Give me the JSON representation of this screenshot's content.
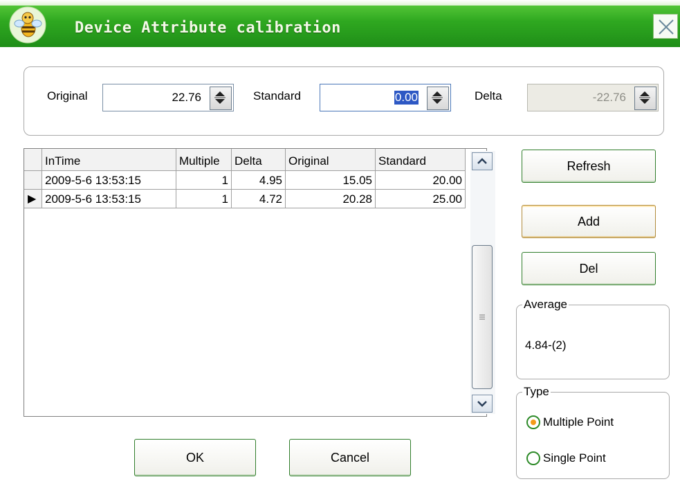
{
  "window": {
    "title": "Device Attribute calibration"
  },
  "fields": {
    "original": {
      "label": "Original",
      "value": "22.76"
    },
    "standard": {
      "label": "Standard",
      "value": "0.00"
    },
    "delta": {
      "label": "Delta",
      "value": "-22.76"
    }
  },
  "grid": {
    "columns": [
      "InTime",
      "Multiple",
      "Delta",
      "Original",
      "Standard"
    ],
    "rows": [
      [
        "2009-5-6 13:53:15",
        "1",
        "4.95",
        "15.05",
        "20.00"
      ],
      [
        "2009-5-6 13:53:15",
        "1",
        "4.72",
        "20.28",
        "25.00"
      ]
    ],
    "current_row_marker": "▶"
  },
  "buttons": {
    "refresh": "Refresh",
    "add": "Add",
    "del": "Del",
    "ok": "OK",
    "cancel": "Cancel"
  },
  "average": {
    "title": "Average",
    "value": "4.84-(2)"
  },
  "type": {
    "title": "Type",
    "options": [
      "Multiple Point",
      "Single Point"
    ],
    "selected": "Multiple Point"
  },
  "icons": [
    "app-bee-icon",
    "close-icon",
    "spin-up-icon",
    "spin-down-icon",
    "scroll-up-icon",
    "scroll-down-icon",
    "scroll-grip-icon",
    "row-pointer-icon"
  ],
  "colors": {
    "titlebar": "#2fa820",
    "accent_border": "#2f7d2a",
    "radio_dot": "#f39b1a"
  }
}
